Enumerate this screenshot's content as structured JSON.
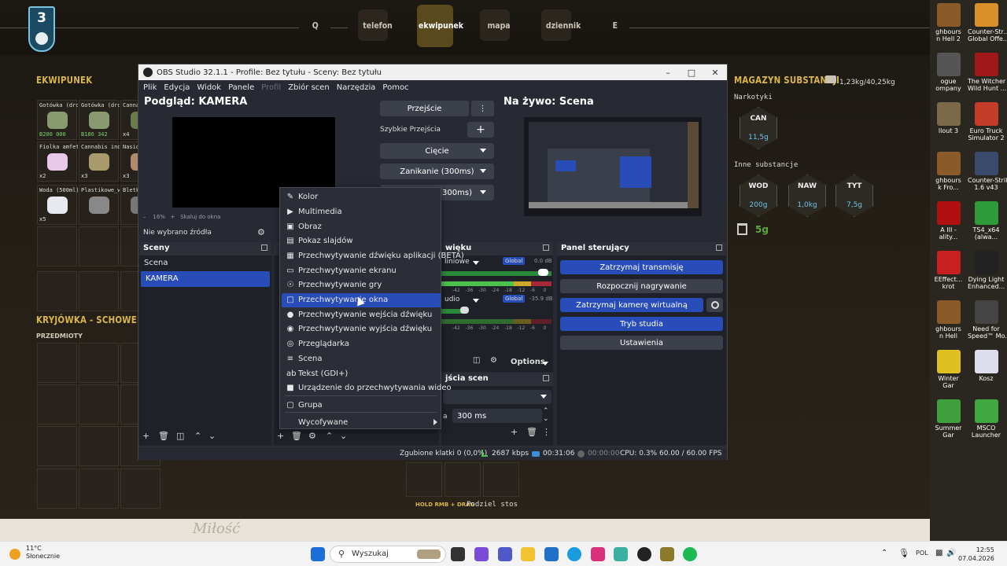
{
  "game": {
    "level": "3",
    "nav": [
      "Q",
      "telefon",
      "ekwipunek",
      "mapa",
      "dziennik",
      "E"
    ],
    "inventory_title": "EKWIPUNEK",
    "inventory_slots": [
      {
        "name": "Gotówka (dro",
        "value": "B200 000",
        "count": ""
      },
      {
        "name": "Gotówka (dro",
        "value": "B186 342",
        "count": ""
      },
      {
        "name": "Cannabis ind",
        "value": "",
        "count": "x4"
      },
      {
        "name": "Fiolka amfet",
        "value": "",
        "count": "x2"
      },
      {
        "name": "Cannabis ind (5g)",
        "value": "",
        "count": "x3"
      },
      {
        "name": "Nasiono ind",
        "value": "",
        "count": "x3"
      },
      {
        "name": "Woda (500ml)",
        "value": "",
        "count": "x5"
      },
      {
        "name": "Plastikowe_w",
        "value": "",
        "count": ""
      },
      {
        "name": "Bletki",
        "value": "",
        "count": ""
      }
    ],
    "stash_title": "KRYJÓWKA - SCHOWEK",
    "stash_sub": "PRZEDMIOTY",
    "substances_title": "MAGAZYN SUBSTANCJI",
    "substances_weight": "1,23kg/40,25kg",
    "narcotics_label": "Narkotyki",
    "narcotics": [
      {
        "code": "CAN",
        "amount": "11,5g"
      }
    ],
    "other_label": "Inne substancje",
    "other": [
      {
        "code": "WOD",
        "amount": "200g"
      },
      {
        "code": "NAW",
        "amount": "1,0kg"
      },
      {
        "code": "TYT",
        "amount": "7,5g"
      }
    ],
    "trash_amount": "5g",
    "hint_left": "HOLD RMB + DRAG",
    "hint_right": "Podziel stos",
    "signature": "Miłość"
  },
  "desktop_icons": [
    {
      "label": "ghbours\nn Hell 2",
      "color": "#8a5a2b"
    },
    {
      "label": "Counter-Str...\nGlobal Offe...",
      "color": "#d9902a"
    },
    {
      "label": "ogue\nompany",
      "color": "#555"
    },
    {
      "label": "The Witcher 3\nWild Hunt ...",
      "color": "#a01818"
    },
    {
      "label": "llout 3",
      "color": "#7a6a4a"
    },
    {
      "label": "Euro Truck\nSimulator 2",
      "color": "#c43d2a"
    },
    {
      "label": "ghbours\nk Fro...",
      "color": "#8a5a2b"
    },
    {
      "label": "Counter-Strike\n1.6 v43",
      "color": "#3a4a6a"
    },
    {
      "label": "A III -\nality...",
      "color": "#b01010"
    },
    {
      "label": "TS4_x64\n(alwa...",
      "color": "#2f9a3a"
    },
    {
      "label": "EEffect...\nkrot",
      "color": "#c82020"
    },
    {
      "label": "Dying Light\nEnhanced...",
      "color": "#222"
    },
    {
      "label": "ghbours\nn Hell",
      "color": "#8a5a2b"
    },
    {
      "label": "Need for\nSpeed™ Mo...",
      "color": "#444"
    },
    {
      "label": "Winter\nGar",
      "color": "#e0c020"
    },
    {
      "label": "Kosz",
      "color": "#dde"
    },
    {
      "label": "Summer\nGar",
      "color": "#40a040"
    },
    {
      "label": "MSCO\nLauncher",
      "color": "#40a840"
    }
  ],
  "obs": {
    "title": "OBS Studio 32.1.1 - Profile: Bez tytułu - Sceny: Bez tytułu",
    "menu": [
      "Plik",
      "Edycja",
      "Widok",
      "Panele",
      "Profil",
      "Zbiór scen",
      "Narzędzia",
      "Pomoc"
    ],
    "preview_title": "Podgląd: KAMERA",
    "live_title": "Na żywo: Scena",
    "zoom": "16%",
    "zoom_fit": "Skaluj do okna",
    "no_source": "Nie wybrano źródła",
    "transition_btn": "Przejście",
    "quick_transitions": "Szybkie Przejścia",
    "cut": "Cięcie",
    "fade": "Zanikanie (300ms)",
    "fade2": "ni (300ms)",
    "scenes_title": "Sceny",
    "scenes": [
      "Scena",
      "KAMERA"
    ],
    "audio_title": "więku",
    "audio_tracks": [
      {
        "name": "liniowe",
        "level": "0.0 dB",
        "tag": "Global"
      },
      {
        "name": "udio",
        "level": "-35.9 dB",
        "tag": "Global"
      }
    ],
    "meter_ticks": [
      "-42",
      "-36",
      "-30",
      "-24",
      "-18",
      "-12",
      "-6",
      "0"
    ],
    "options": "Options",
    "transitions_title": "jścia scen",
    "duration": "300 ms",
    "duration_label": "a",
    "controls_title": "Panel sterujący",
    "controls": {
      "stop_stream": "Zatrzymaj transmisję",
      "start_rec": "Rozpocznij nagrywanie",
      "stop_vcam": "Zatrzymaj kamerę wirtualną",
      "studio": "Tryb studia",
      "settings": "Ustawienia"
    },
    "status": {
      "dropped": "Zgubione klatki 0 (0,0%)",
      "bitrate": "2687 kbps",
      "stream_time": "00:31:06",
      "rec_time": "00:00:00",
      "cpu": "CPU: 0.3%",
      "fps": "60.00 / 60.00 FPS"
    },
    "context_menu": [
      {
        "label": "Kolor",
        "icon": "✎"
      },
      {
        "label": "Multimedia",
        "icon": "▶"
      },
      {
        "label": "Obraz",
        "icon": "▣"
      },
      {
        "label": "Pokaz slajdów",
        "icon": "▤"
      },
      {
        "label": "Przechwytywanie dźwięku aplikacji (BETA)",
        "icon": "▦"
      },
      {
        "label": "Przechwytywanie ekranu",
        "icon": "▭"
      },
      {
        "label": "Przechwytywanie gry",
        "icon": "☉"
      },
      {
        "label": "Przechwytywanie okna",
        "icon": "□"
      },
      {
        "label": "Przechwytywanie wejścia dźwięku",
        "icon": "●"
      },
      {
        "label": "Przechwytywanie wyjścia dźwięku",
        "icon": "◉"
      },
      {
        "label": "Przeglądarka",
        "icon": "◎"
      },
      {
        "label": "Scena",
        "icon": "≡"
      },
      {
        "label": "Tekst (GDI+)",
        "icon": "ab"
      },
      {
        "label": "Urządzenie do przechwytywania wideo",
        "icon": "■"
      },
      {
        "label": "Grupa",
        "icon": "▢"
      },
      {
        "label": "Wycofywane",
        "icon": ""
      }
    ],
    "highlighted_index": 7
  },
  "taskbar": {
    "temp": "11°C",
    "weather": "Słonecznie",
    "search": "Wyszukaj",
    "lang": "POL",
    "time": "12:55",
    "date": "07.04.2026"
  }
}
